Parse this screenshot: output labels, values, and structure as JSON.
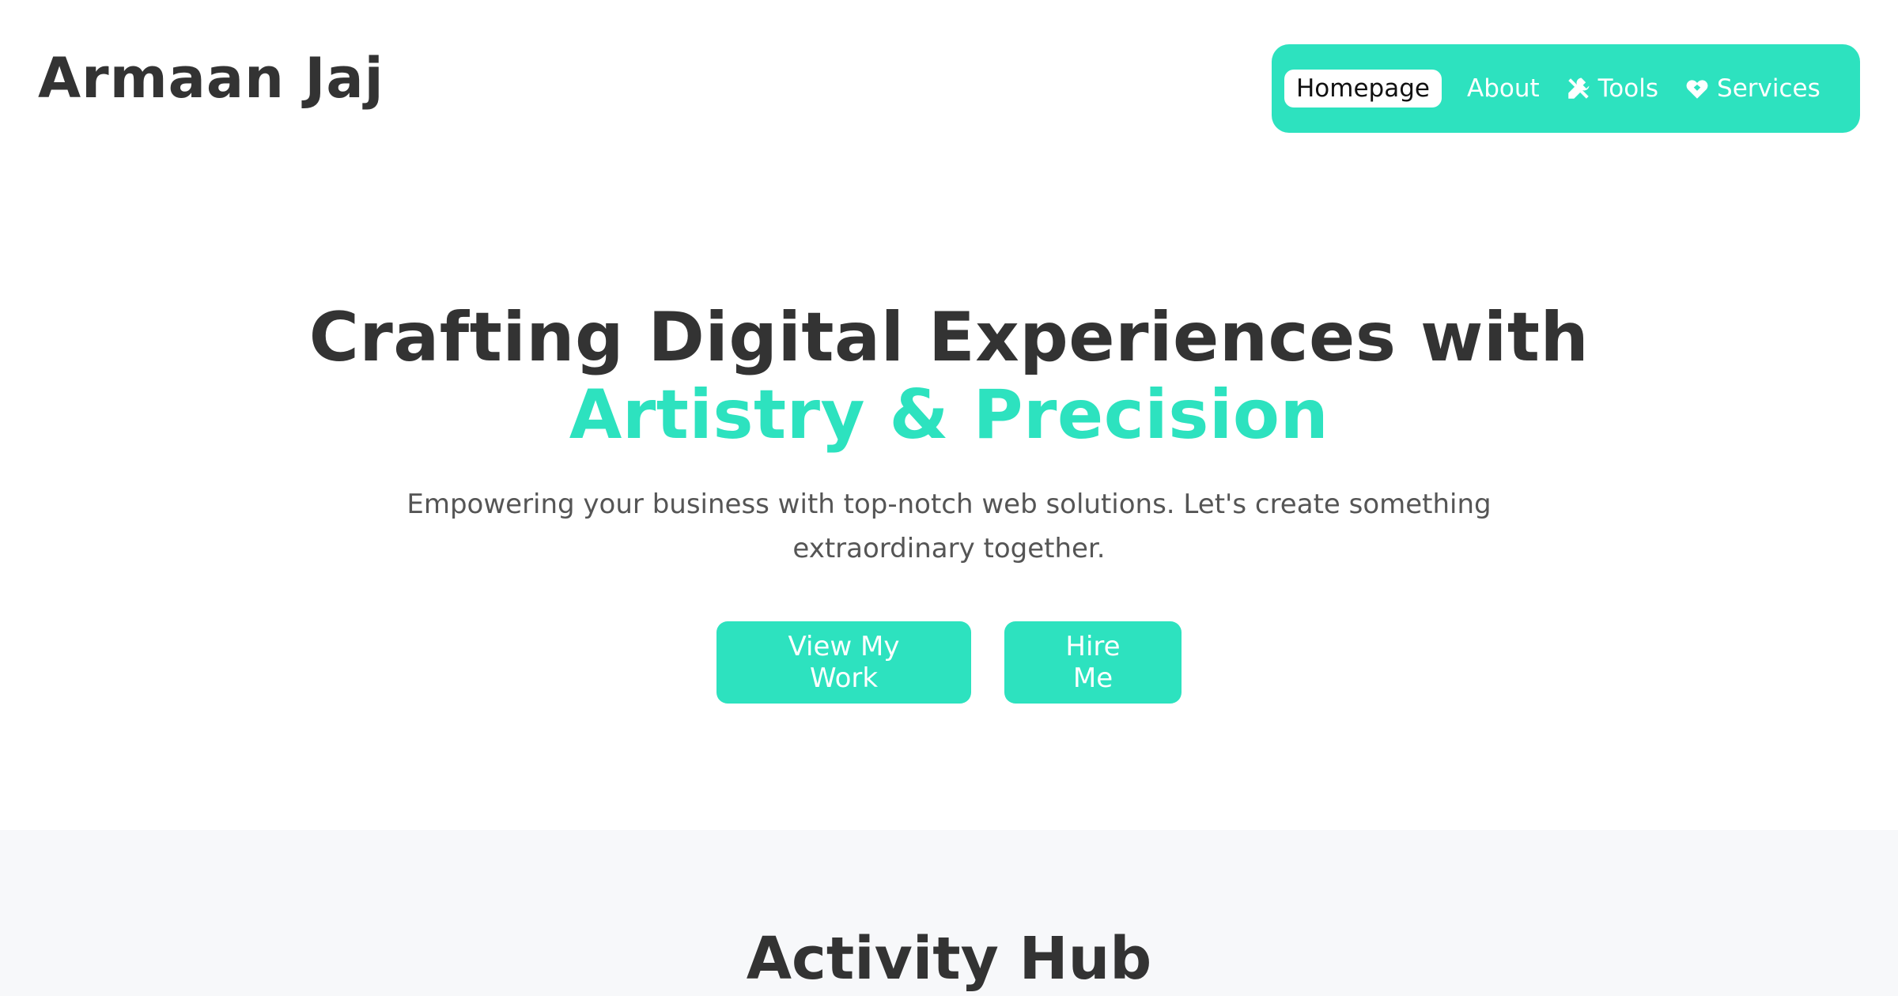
{
  "header": {
    "brand": "Armaan Jaj",
    "nav": [
      {
        "label": "Homepage",
        "icon": null,
        "active": true
      },
      {
        "label": "About",
        "icon": null,
        "active": false
      },
      {
        "label": "Tools",
        "icon": "tools-icon",
        "active": false
      },
      {
        "label": "Services",
        "icon": "handshake-icon",
        "active": false
      }
    ]
  },
  "hero": {
    "title_line1": "Crafting Digital Experiences with",
    "title_line2": "Artistry & Precision",
    "subtitle": "Empowering your business with top-notch web solutions. Let's create something extraordinary together.",
    "primary_button": "View My Work",
    "secondary_button": "Hire Me"
  },
  "activity": {
    "title": "Activity Hub"
  },
  "colors": {
    "accent": "#2de2bf",
    "text": "#333333",
    "muted_text": "#555555",
    "section_bg": "#f7f8fa"
  }
}
